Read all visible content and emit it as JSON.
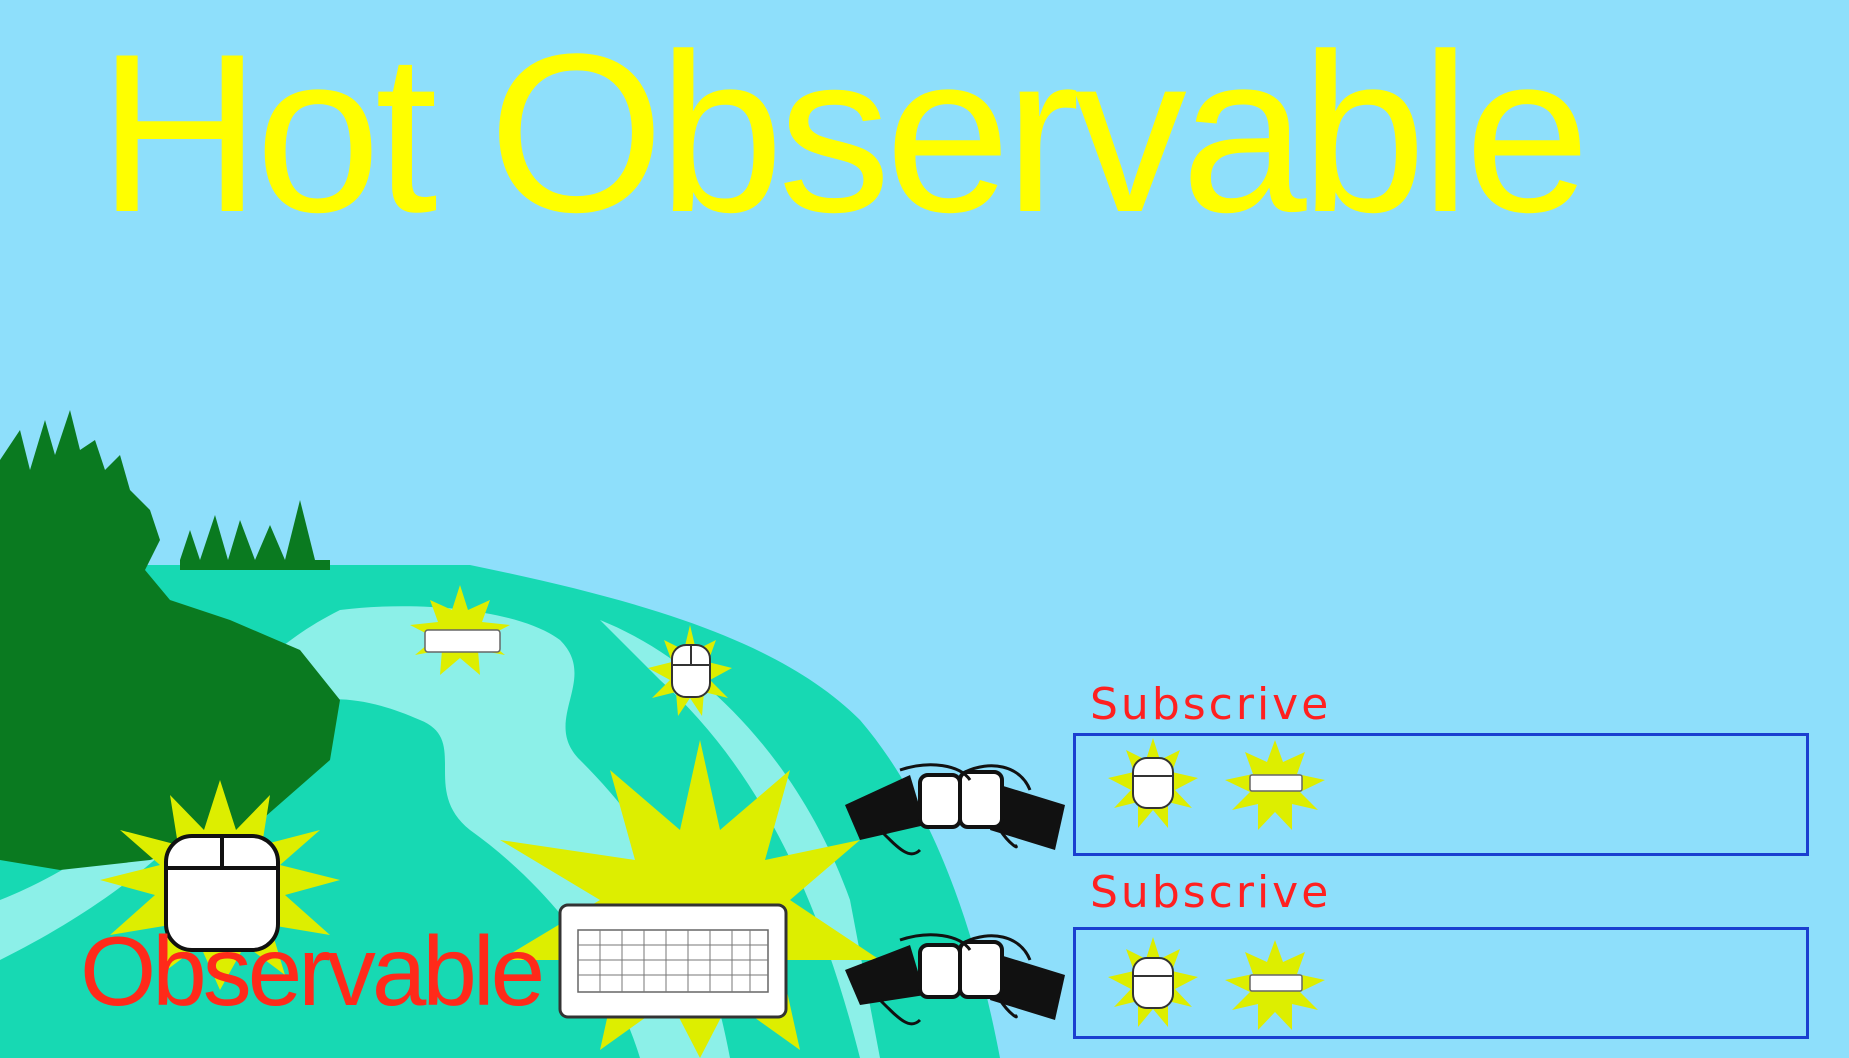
{
  "title": "Hot Observable",
  "observable_label": "Observable",
  "subscriptions": [
    {
      "label": "Subscrive",
      "events": [
        "mouse-icon",
        "keyboard-icon"
      ]
    },
    {
      "label": "Subscrive",
      "events": [
        "mouse-icon",
        "keyboard-icon"
      ]
    }
  ],
  "colors": {
    "sky": "#8edffb",
    "title": "#ffff00",
    "forest": "#0a7a20",
    "river": "#17d9b3",
    "subscribe_text": "#ff2020",
    "subscribe_box": "#1a3fd0",
    "burst": "#ddee00"
  }
}
